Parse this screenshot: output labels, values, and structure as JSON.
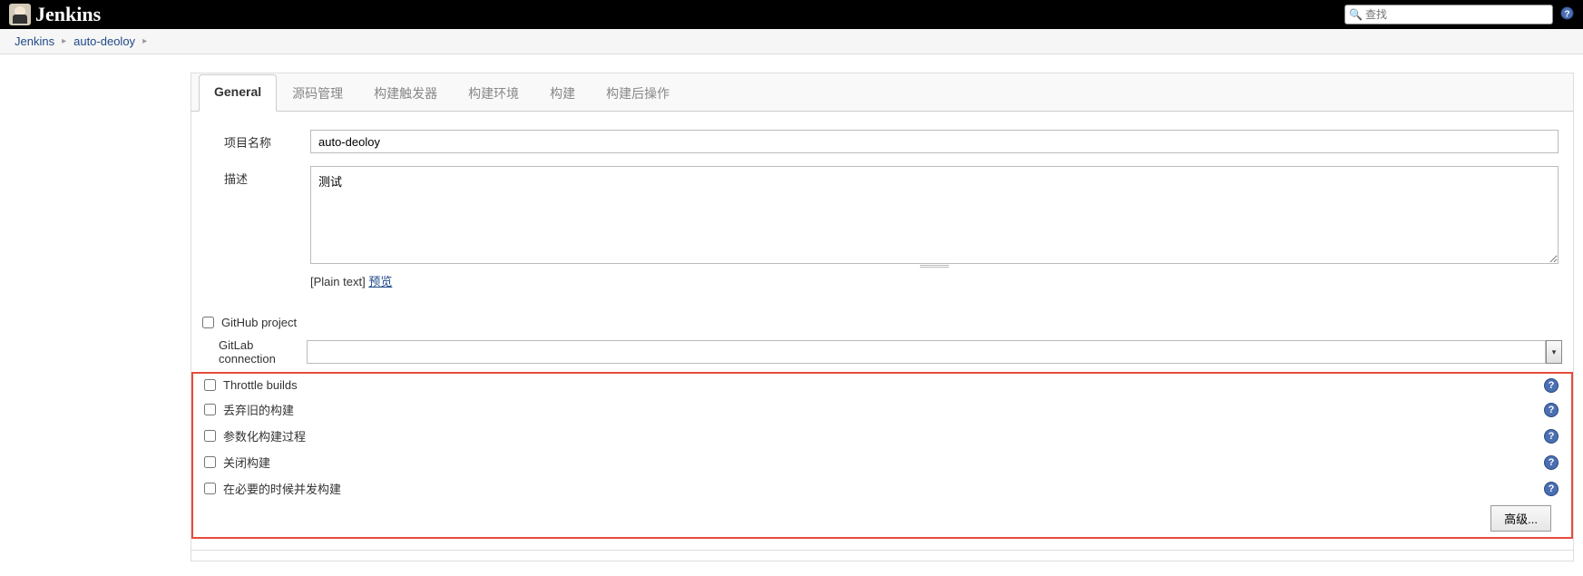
{
  "header": {
    "logo_text": "Jenkins",
    "search_placeholder": "查找"
  },
  "breadcrumbs": {
    "items": [
      "Jenkins",
      "auto-deoloy"
    ]
  },
  "tabs": {
    "items": [
      {
        "label": "General",
        "active": true
      },
      {
        "label": "源码管理",
        "active": false
      },
      {
        "label": "构建触发器",
        "active": false
      },
      {
        "label": "构建环境",
        "active": false
      },
      {
        "label": "构建",
        "active": false
      },
      {
        "label": "构建后操作",
        "active": false
      }
    ]
  },
  "form": {
    "project_name_label": "项目名称",
    "project_name_value": "auto-deoloy",
    "description_label": "描述",
    "description_value": "测试",
    "format_prefix": "[Plain text] ",
    "preview_link": "预览",
    "github_project_label": "GitHub project",
    "gitlab_conn_label": "GitLab connection",
    "gitlab_conn_value": "",
    "options": {
      "throttle": "Throttle builds",
      "discard_old": "丢弃旧的构建",
      "parameterized": "参数化构建过程",
      "disable": "关闭构建",
      "concurrent": "在必要的时候并发构建"
    },
    "advanced_button": "高级..."
  }
}
